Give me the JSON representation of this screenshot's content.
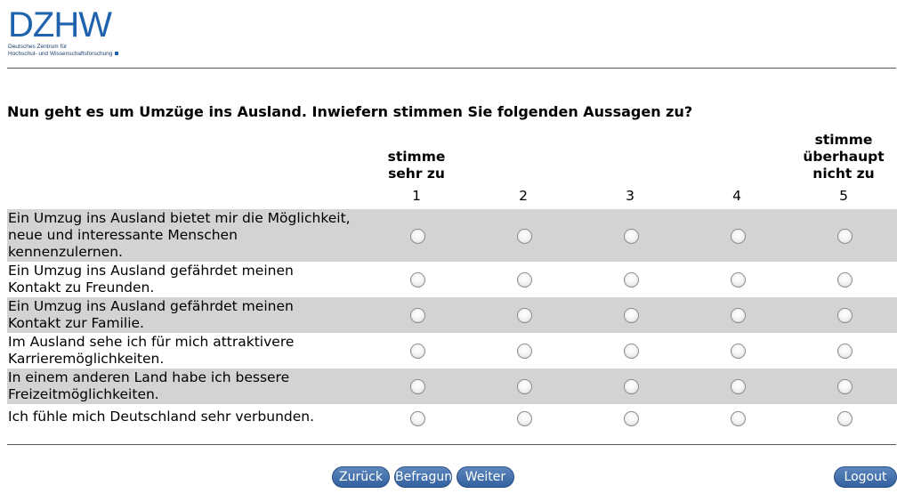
{
  "logo": {
    "letters": "DZHW",
    "sub_line1": "Deutsches Zentrum für",
    "sub_line2": "Hochschul- und Wissenschaftsforschung"
  },
  "question": "Nun geht es um Umzüge ins Ausland. Inwiefern stimmen Sie folgenden Aussagen zu?",
  "scale": {
    "low_anchor": [
      "stimme",
      "sehr zu"
    ],
    "high_anchor": [
      "stimme",
      "überhaupt",
      "nicht zu"
    ],
    "points": [
      "1",
      "2",
      "3",
      "4",
      "5"
    ]
  },
  "items": [
    {
      "lines": [
        "Ein Umzug ins Ausland bietet mir die Möglichkeit,",
        "neue und interessante Menschen",
        "kennenzulernen."
      ]
    },
    {
      "lines": [
        "Ein Umzug ins Ausland gefährdet meinen",
        "Kontakt zu Freunden."
      ]
    },
    {
      "lines": [
        "Ein Umzug ins Ausland gefährdet meinen",
        "Kontakt zur Familie."
      ]
    },
    {
      "lines": [
        "Im Ausland sehe ich für mich attraktivere",
        "Karrieremöglichkeiten."
      ]
    },
    {
      "lines": [
        "In einem anderen Land habe ich bessere",
        "Freizeitmöglichkeiten."
      ]
    },
    {
      "lines": [
        "Ich fühle mich Deutschland sehr verbunden."
      ]
    }
  ],
  "buttons": {
    "back": "Zurück",
    "survey": "Befragung",
    "next": "Weiter",
    "logout": "Logout"
  },
  "colors": {
    "brand": "#1f63ae",
    "row_shade": "#d3d3d3",
    "button": "#3f6ea8"
  }
}
